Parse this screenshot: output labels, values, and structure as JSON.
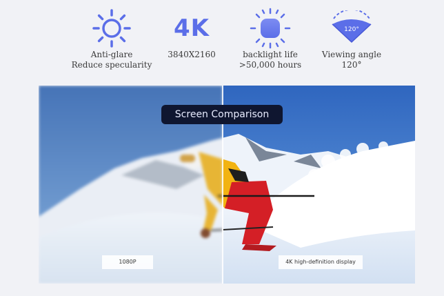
{
  "features": [
    {
      "icon": "sun-icon",
      "line1": "Anti-glare",
      "line2": "Reduce specularity"
    },
    {
      "icon": "4k-badge",
      "badge": "4K",
      "line1": "3840X2160",
      "line2": ""
    },
    {
      "icon": "backlight-icon",
      "line1": "backlight life",
      "line2": ">50,000 hours"
    },
    {
      "icon": "viewing-angle-icon",
      "angle": "120°",
      "line1": "Viewing angle",
      "line2": "120°"
    }
  ],
  "comparison": {
    "title": "Screen Comparison",
    "left_label": "1080P",
    "right_label": "4K high-definition display"
  },
  "colors": {
    "accent": "#5b6ee8",
    "pill_bg": "#0f1630"
  }
}
